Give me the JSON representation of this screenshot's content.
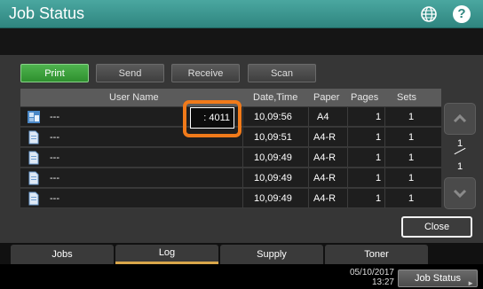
{
  "title": "Job Status",
  "mode_buttons": [
    "Print",
    "Send",
    "Receive",
    "Scan"
  ],
  "columns": [
    "User Name",
    "Date,Time",
    "Paper",
    "Pages",
    "Sets"
  ],
  "rows": [
    {
      "user": "---",
      "datetime": "10,09:56",
      "paper": "A4",
      "pages": "1",
      "sets": "1",
      "icon": "copy-job-icon"
    },
    {
      "user": "---",
      "datetime": "10,09:51",
      "paper": "A4-R",
      "pages": "1",
      "sets": "1",
      "icon": "document-icon"
    },
    {
      "user": "---",
      "datetime": "10,09:49",
      "paper": "A4-R",
      "pages": "1",
      "sets": "1",
      "icon": "document-icon"
    },
    {
      "user": "---",
      "datetime": "10,09:49",
      "paper": "A4-R",
      "pages": "1",
      "sets": "1",
      "icon": "document-icon"
    },
    {
      "user": "---",
      "datetime": "10,09:49",
      "paper": "A4-R",
      "pages": "1",
      "sets": "1",
      "icon": "document-icon"
    }
  ],
  "highlighted_value": ": 4011",
  "page_indicator": {
    "current": "1",
    "total": "1"
  },
  "close_label": "Close",
  "tabs": [
    "Jobs",
    "Log",
    "Supply",
    "Toner"
  ],
  "footer": {
    "date": "05/10/2017",
    "time": "13:27",
    "job_status_label": "Job Status"
  },
  "colors": {
    "title_bar": "#3a9a93",
    "active_button": "#3fa33f",
    "highlight_border": "#f07a1a",
    "active_tab_underline": "#d9a64a"
  }
}
